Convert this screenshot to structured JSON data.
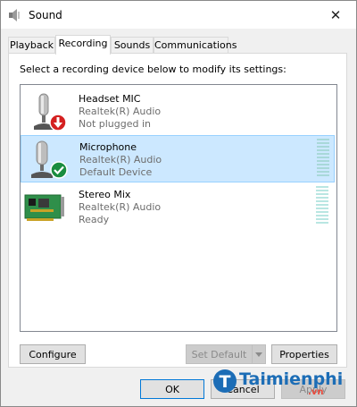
{
  "window": {
    "title": "Sound",
    "close_glyph": "✕",
    "icon": "speaker-icon"
  },
  "tabs": [
    {
      "label": "Playback",
      "active": false
    },
    {
      "label": "Recording",
      "active": true
    },
    {
      "label": "Sounds",
      "active": false
    },
    {
      "label": "Communications",
      "active": false
    }
  ],
  "instruction": "Select a recording device below to modify its settings:",
  "devices": [
    {
      "name": "Headset MIC",
      "driver": "Realtek(R) Audio",
      "status": "Not plugged in",
      "icon": "microphone-icon",
      "badge": "unplugged-badge-icon",
      "selected": false
    },
    {
      "name": "Microphone",
      "driver": "Realtek(R) Audio",
      "status": "Default Device",
      "icon": "microphone-icon",
      "badge": "default-check-badge-icon",
      "selected": true
    },
    {
      "name": "Stereo Mix",
      "driver": "Realtek(R) Audio",
      "status": "Ready",
      "icon": "sound-card-icon",
      "badge": "",
      "selected": false
    }
  ],
  "buttons": {
    "configure": "Configure",
    "set_default": "Set Default",
    "properties": "Properties",
    "ok": "OK",
    "cancel": "Cancel",
    "apply": "Apply"
  },
  "watermark": {
    "brand": "Taimienphi",
    "suffix": ".vn"
  },
  "colors": {
    "selection": "#cce8ff",
    "accent": "#0078d7",
    "default_badge": "#1a8d3f",
    "unplugged_badge": "#d42020"
  }
}
